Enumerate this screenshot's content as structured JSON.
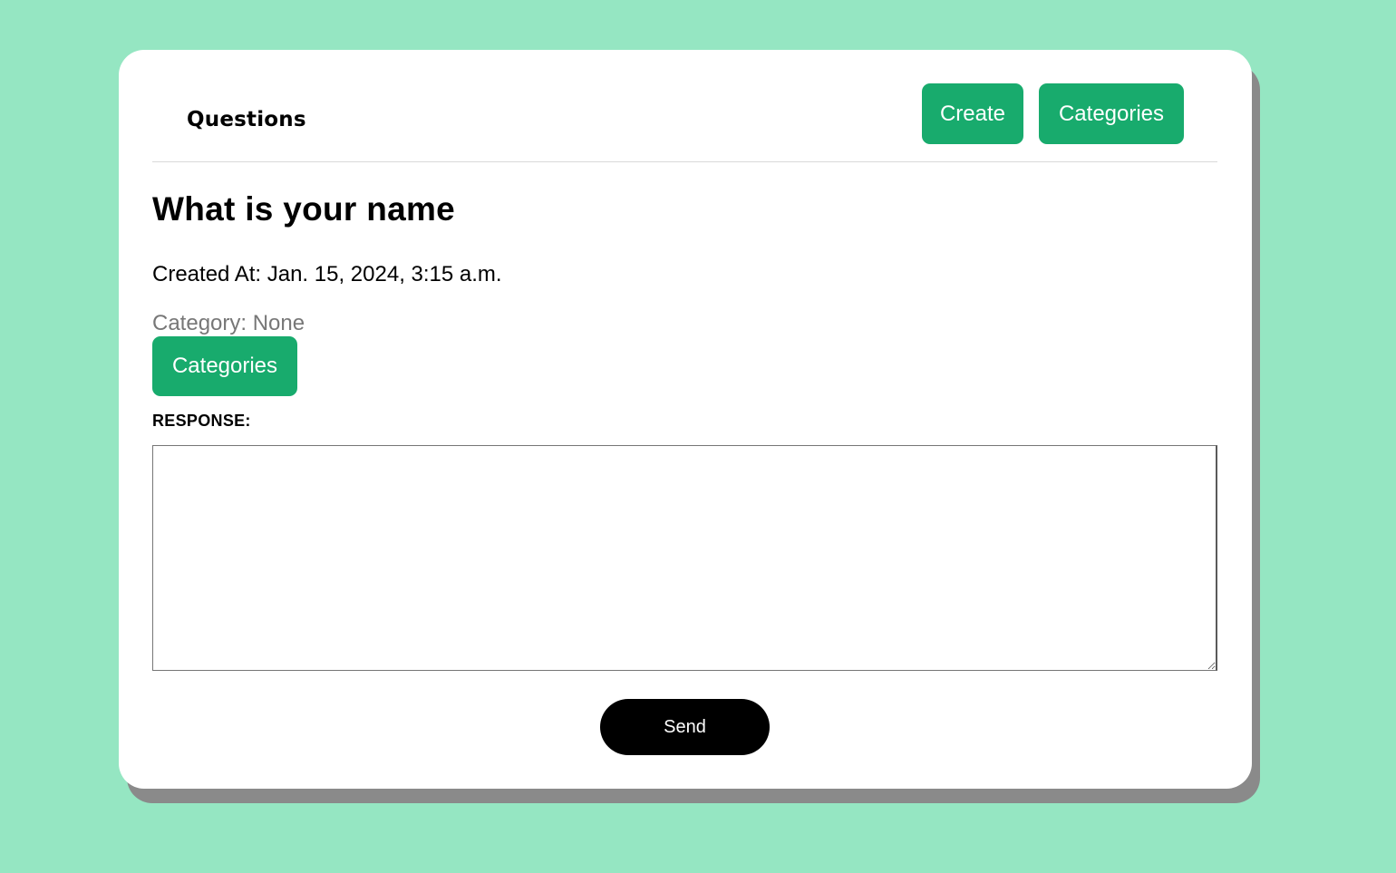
{
  "nav": {
    "brand": "Questions",
    "create_label": "Create",
    "categories_label": "Categories"
  },
  "question": {
    "title": "What is your name",
    "created_at": "Created At: Jan. 15, 2024, 3:15 a.m.",
    "category": "Category: None",
    "categories_button": "Categories"
  },
  "response": {
    "label": "RESPONSE:",
    "value": "",
    "send_label": "Send"
  },
  "colors": {
    "background": "#95e6c2",
    "accent": "#18ab6d",
    "send_button": "#000000",
    "card_shadow": "#8a8a8a"
  }
}
